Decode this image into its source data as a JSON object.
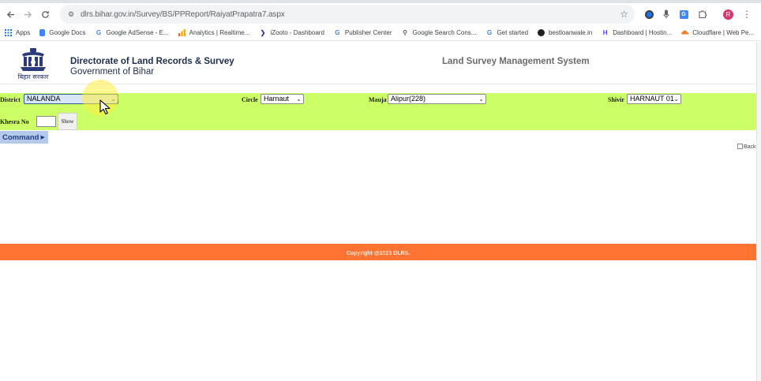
{
  "browser": {
    "url": "dlrs.bihar.gov.in/Survey/BS/PPReport/RaiyatPrapatra7.aspx",
    "profile_initial": "R",
    "icons": {
      "back": "back-arrow-icon",
      "forward": "forward-arrow-icon",
      "reload": "reload-icon",
      "site_info": "tune-icon",
      "bookmark": "star-icon",
      "menu": "kebab-menu-icon"
    },
    "bookmarks": [
      {
        "label": "Apps",
        "icon": "apps-grid-icon",
        "color": "#1a73e8"
      },
      {
        "label": "Google Docs",
        "icon": "docs-icon",
        "color": "#4285f4"
      },
      {
        "label": "Google AdSense - E...",
        "icon": "google-icon",
        "color": "#ea4335"
      },
      {
        "label": "Analytics | Realtime...",
        "icon": "analytics-icon",
        "color": "#f9ab00"
      },
      {
        "label": "iZooto - Dashboard",
        "icon": "izooto-icon",
        "color": "#3a2d9c"
      },
      {
        "label": "Publisher Center",
        "icon": "google-icon",
        "color": "#ea4335"
      },
      {
        "label": "Google Search Cons...",
        "icon": "search-console-icon",
        "color": "#5f6368"
      },
      {
        "label": "Get started",
        "icon": "google-icon",
        "color": "#ea4335"
      },
      {
        "label": "bestloanwale.in",
        "icon": "globe-icon",
        "color": "#202124"
      },
      {
        "label": "Dashboard | Hostin...",
        "icon": "hostinger-icon",
        "color": "#673de6"
      },
      {
        "label": "Cloudflare | Web Pe...",
        "icon": "cloudflare-icon",
        "color": "#f38020"
      }
    ]
  },
  "site": {
    "emblem_caption": "बिहार सरकार",
    "title": "Directorate of Land Records & Survey",
    "subtitle": "Government of Bihar",
    "system_title": "Land Survey Management System"
  },
  "filters": {
    "district_label": "District",
    "district_value": "NALANDA",
    "circle_label": "Circle",
    "circle_value": "Harnaut",
    "mauja_label": "Mauja",
    "mauja_value": "Alipur(228)",
    "shivir_label": "Shivir",
    "shivir_value": "HARNAUT 01",
    "khesra_label": "Khesra No",
    "khesra_value": "",
    "show_label": "Show"
  },
  "command": {
    "label": "Command"
  },
  "back_image_alt": "Back",
  "footer": {
    "copyright": "Copyright @2023 DLRS."
  },
  "colors": {
    "filter_panel": "#ccff66",
    "footer": "#ff7433",
    "command_bar": "#b5c9ea",
    "cursor_highlight": "#ffec3c"
  }
}
